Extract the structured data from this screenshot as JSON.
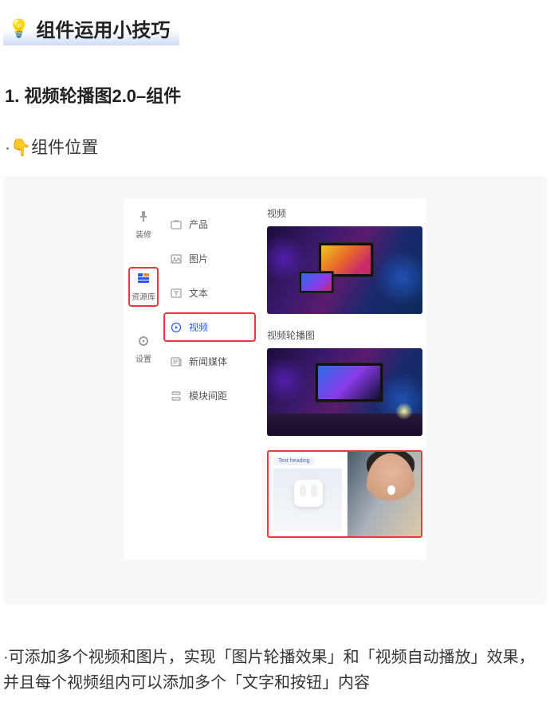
{
  "page": {
    "title": "组件运用小技巧",
    "title_emoji": "💡"
  },
  "section": {
    "heading": "1. 视频轮播图2.0–组件",
    "sub_emoji": "👇",
    "sub_text": "组件位置"
  },
  "rail": {
    "items": [
      {
        "label": "装修",
        "name": "decorate"
      },
      {
        "label": "资源库",
        "name": "library"
      },
      {
        "label": "设置",
        "name": "settings"
      }
    ]
  },
  "categories": [
    {
      "label": "产品",
      "name": "product"
    },
    {
      "label": "图片",
      "name": "image"
    },
    {
      "label": "文本",
      "name": "text"
    },
    {
      "label": "视频",
      "name": "video"
    },
    {
      "label": "新闻媒体",
      "name": "news"
    },
    {
      "label": "模块间距",
      "name": "spacing"
    }
  ],
  "preview": {
    "group1_title": "视频",
    "group2_title": "视频轮播图",
    "text_heading": "Text heading"
  },
  "body": {
    "paragraph": "·可添加多个视频和图片，实现「图片轮播效果」和「视频自动播放」效果，并且每个视频组内可以添加多个「文字和按钮」内容"
  }
}
